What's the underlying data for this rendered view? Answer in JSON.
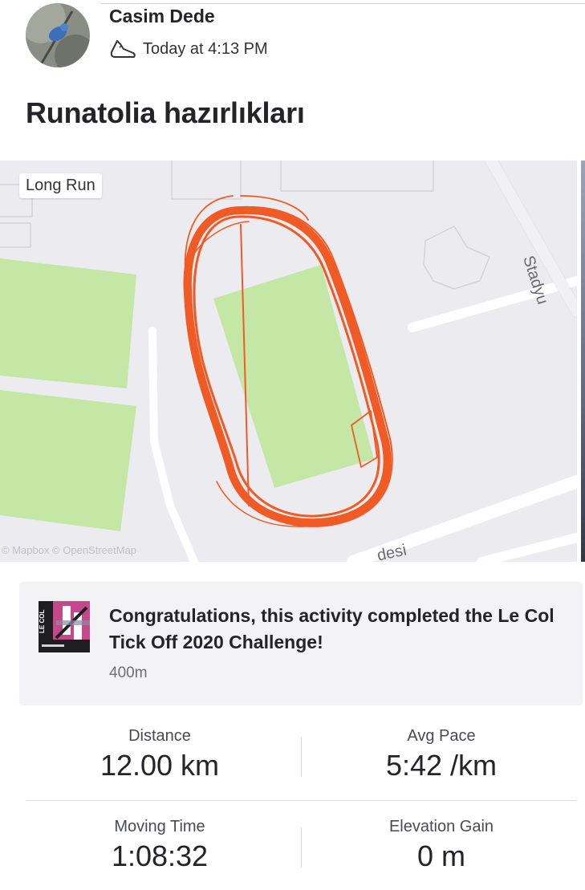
{
  "header": {
    "athlete_name": "Casim Dede",
    "timestamp": "Today at 4:13 PM",
    "activity_icon": "run-shoe-icon",
    "avatar": "avatar-bird-photo"
  },
  "activity": {
    "title": "Runatolia hazırlıkları"
  },
  "map": {
    "tag_label": "Long Run",
    "attribution": "© Mapbox © OpenStreetMap",
    "street_labels": [
      "Stadyu",
      "desi"
    ],
    "colors": {
      "background": "#ecebf0",
      "grass": "#c5e7a6",
      "road": "#ffffff",
      "route": "#f05a24"
    }
  },
  "challenge": {
    "icon": "le-col-badge-icon",
    "badge_text": "LE COL",
    "text": "Congratulations, this activity completed the Le Col Tick Off 2020 Challenge!",
    "subtext": "400m"
  },
  "stats": [
    {
      "label": "Distance",
      "value": "12.00 km"
    },
    {
      "label": "Avg Pace",
      "value": "5:42 /km"
    },
    {
      "label": "Moving Time",
      "value": "1:08:32"
    },
    {
      "label": "Elevation Gain",
      "value": "0 m"
    }
  ]
}
